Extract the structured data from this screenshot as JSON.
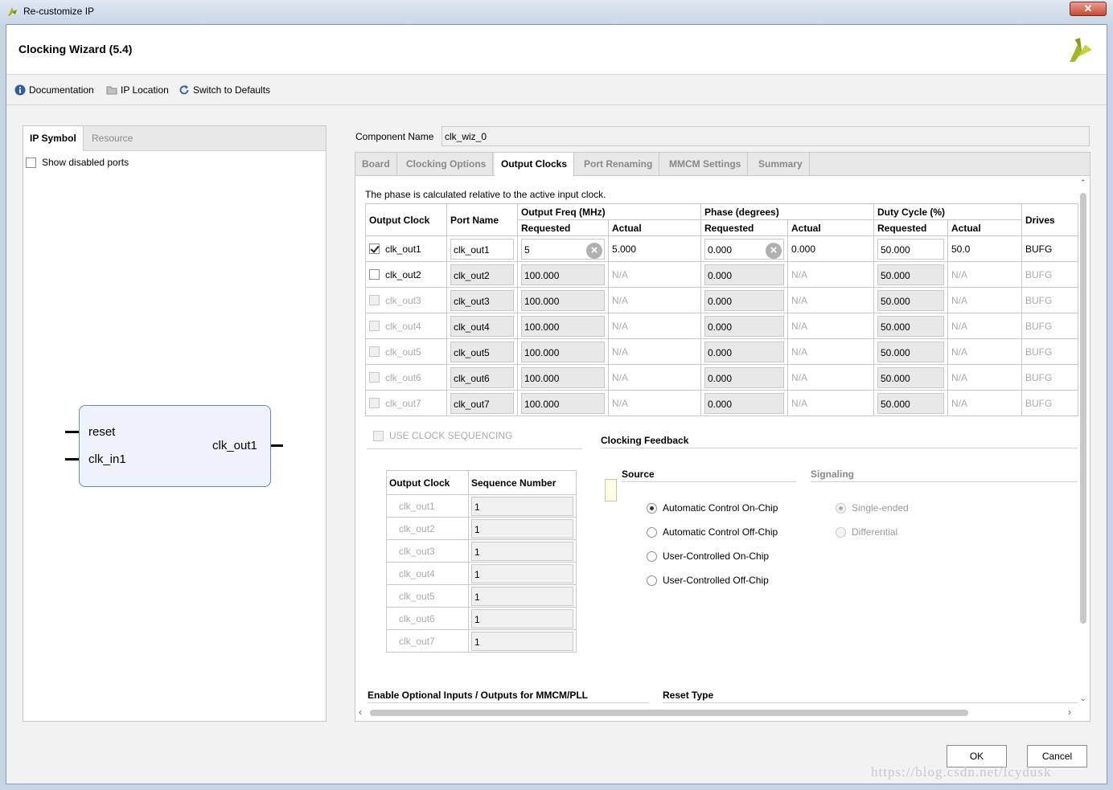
{
  "window": {
    "title": "Re-customize IP",
    "close_label": "✕"
  },
  "header": {
    "title": "Clocking Wizard (5.4)"
  },
  "toolbar": {
    "documentation": "Documentation",
    "ip_location": "IP Location",
    "switch_defaults": "Switch to Defaults"
  },
  "left_panel": {
    "tabs": [
      "IP Symbol",
      "Resource"
    ],
    "show_disabled_ports": "Show disabled ports",
    "symbol": {
      "inputs": [
        "reset",
        "clk_in1"
      ],
      "outputs": [
        "clk_out1"
      ]
    }
  },
  "component": {
    "label": "Component Name",
    "value": "clk_wiz_0"
  },
  "tabs": [
    "Board",
    "Clocking Options",
    "Output Clocks",
    "Port Renaming",
    "MMCM Settings",
    "Summary"
  ],
  "output_clocks": {
    "note": "The phase is calculated relative to the active input clock.",
    "headers": {
      "output_clock": "Output Clock",
      "port_name": "Port Name",
      "output_freq": "Output Freq (MHz)",
      "phase": "Phase (degrees)",
      "duty_cycle": "Duty Cycle (%)",
      "requested": "Requested",
      "actual": "Actual",
      "drives": "Drives"
    },
    "rows": [
      {
        "name": "clk_out1",
        "port": "clk_out1",
        "freq_req": "5",
        "freq_act": "5.000",
        "phase_req": "0.000",
        "phase_act": "0.000",
        "duty_req": "50.000",
        "duty_act": "50.0",
        "drives": "BUFG"
      },
      {
        "name": "clk_out2",
        "port": "clk_out2",
        "freq_req": "100.000",
        "freq_act": "N/A",
        "phase_req": "0.000",
        "phase_act": "N/A",
        "duty_req": "50.000",
        "duty_act": "N/A",
        "drives": "BUFG"
      },
      {
        "name": "clk_out3",
        "port": "clk_out3",
        "freq_req": "100.000",
        "freq_act": "N/A",
        "phase_req": "0.000",
        "phase_act": "N/A",
        "duty_req": "50.000",
        "duty_act": "N/A",
        "drives": "BUFG"
      },
      {
        "name": "clk_out4",
        "port": "clk_out4",
        "freq_req": "100.000",
        "freq_act": "N/A",
        "phase_req": "0.000",
        "phase_act": "N/A",
        "duty_req": "50.000",
        "duty_act": "N/A",
        "drives": "BUFG"
      },
      {
        "name": "clk_out5",
        "port": "clk_out5",
        "freq_req": "100.000",
        "freq_act": "N/A",
        "phase_req": "0.000",
        "phase_act": "N/A",
        "duty_req": "50.000",
        "duty_act": "N/A",
        "drives": "BUFG"
      },
      {
        "name": "clk_out6",
        "port": "clk_out6",
        "freq_req": "100.000",
        "freq_act": "N/A",
        "phase_req": "0.000",
        "phase_act": "N/A",
        "duty_req": "50.000",
        "duty_act": "N/A",
        "drives": "BUFG"
      },
      {
        "name": "clk_out7",
        "port": "clk_out7",
        "freq_req": "100.000",
        "freq_act": "N/A",
        "phase_req": "0.000",
        "phase_act": "N/A",
        "duty_req": "50.000",
        "duty_act": "N/A",
        "drives": "BUFG"
      }
    ]
  },
  "sequencing": {
    "checkbox": "USE CLOCK SEQUENCING",
    "headers": {
      "output_clock": "Output Clock",
      "sequence_number": "Sequence Number"
    },
    "rows": [
      {
        "name": "clk_out1",
        "seq": "1"
      },
      {
        "name": "clk_out2",
        "seq": "1"
      },
      {
        "name": "clk_out3",
        "seq": "1"
      },
      {
        "name": "clk_out4",
        "seq": "1"
      },
      {
        "name": "clk_out5",
        "seq": "1"
      },
      {
        "name": "clk_out6",
        "seq": "1"
      },
      {
        "name": "clk_out7",
        "seq": "1"
      }
    ]
  },
  "feedback": {
    "title": "Clocking Feedback",
    "source_label": "Source",
    "signaling_label": "Signaling",
    "sources": [
      "Automatic Control On-Chip",
      "Automatic Control Off-Chip",
      "User-Controlled On-Chip",
      "User-Controlled Off-Chip"
    ],
    "signaling": [
      "Single-ended",
      "Differential"
    ]
  },
  "bottom_sections": {
    "optional_io": "Enable Optional Inputs / Outputs for MMCM/PLL",
    "reset_type": "Reset Type"
  },
  "buttons": {
    "ok": "OK",
    "cancel": "Cancel"
  },
  "watermark": "https://blog.csdn.net/lcydusk",
  "colors": {
    "accent": "#6a86b8",
    "brand_logo": "#a7b724"
  }
}
